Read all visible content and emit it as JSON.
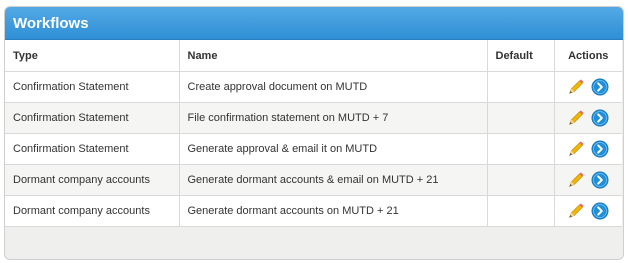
{
  "panel": {
    "title": "Workflows"
  },
  "table": {
    "headers": {
      "type": "Type",
      "name": "Name",
      "default": "Default",
      "actions": "Actions"
    },
    "rows": [
      {
        "type": "Confirmation Statement",
        "name": "Create approval document on MUTD",
        "default": ""
      },
      {
        "type": "Confirmation Statement",
        "name": "File confirmation statement on MUTD + 7",
        "default": ""
      },
      {
        "type": "Confirmation Statement",
        "name": "Generate approval & email it on MUTD",
        "default": ""
      },
      {
        "type": "Dormant company accounts",
        "name": "Generate dormant accounts & email on MUTD + 21",
        "default": ""
      },
      {
        "type": "Dormant company accounts",
        "name": "Generate dormant accounts on MUTD + 21",
        "default": ""
      }
    ]
  },
  "icons": {
    "edit": "pencil-icon",
    "open": "chevron-right-circle-icon"
  },
  "colors": {
    "header_top": "#53a9e5",
    "header_bottom": "#2f8fd6",
    "go_button": "#1f8fd8",
    "pencil": "#f2b705"
  }
}
